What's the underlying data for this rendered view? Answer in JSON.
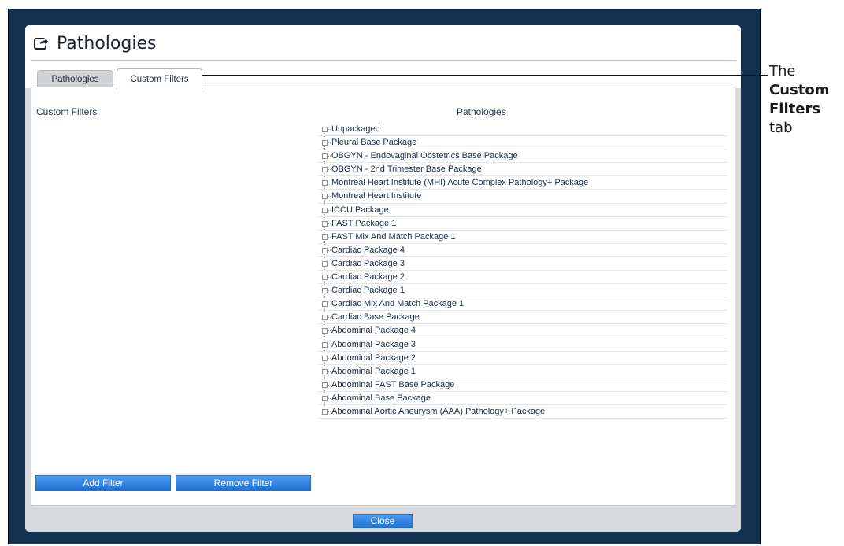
{
  "window": {
    "title": "Pathologies",
    "title_icon": "open-external-icon"
  },
  "tabs": [
    {
      "label": "Pathologies",
      "active": false
    },
    {
      "label": "Custom Filters",
      "active": true
    }
  ],
  "custom_filters": {
    "label": "Custom Filters",
    "add_button": "Add Filter",
    "remove_button": "Remove Filter"
  },
  "pathologies": {
    "header": "Pathologies",
    "items": [
      "Unpackaged",
      "Pleural Base Package",
      "OBGYN - Endovaginal Obstetrics Base Package",
      "OBGYN - 2nd Trimester Base Package",
      "Montreal Heart Institute (MHI) Acute Complex Pathology+ Package",
      "Montreal Heart Institute",
      "ICCU Package",
      "FAST Package 1",
      "FAST Mix And Match Package 1",
      "Cardiac Package 4",
      "Cardiac Package 3",
      "Cardiac Package 2",
      "Cardiac Package 1",
      "Cardiac Mix And Match Package 1",
      "Cardiac Base Package",
      "Abdominal Package 4",
      "Abdominal Package 3",
      "Abdominal Package 2",
      "Abdominal Package 1",
      "Abdominal FAST Base Package",
      "Abdominal Base Package",
      "Abdominal Aortic Aneurysm (AAA) Pathology+ Package"
    ]
  },
  "footer": {
    "close_button": "Close"
  },
  "annotation": {
    "line1": "The",
    "line2": "Custom",
    "line3": "Filters",
    "line4": "tab"
  },
  "colors": {
    "frame": "#123150",
    "button_top": "#4f9df0",
    "button_bottom": "#1e71d6",
    "text": "#1b2c48"
  }
}
